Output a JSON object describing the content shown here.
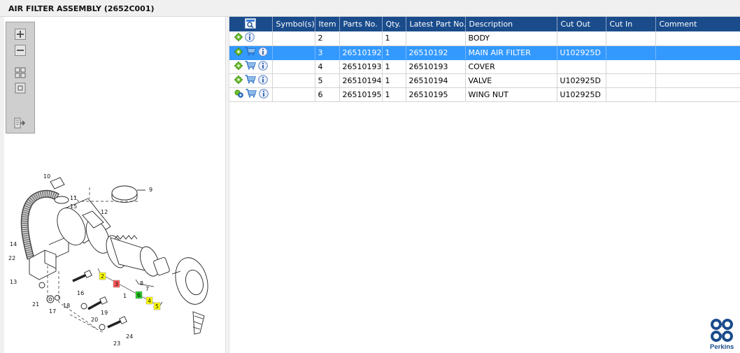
{
  "window": {
    "title": "AIR FILTER ASSEMBLY (2652C001)"
  },
  "colors": {
    "header_bg": "#1a4c8c",
    "selected_row": "#3399ff",
    "highlight_yellow": "#ffff00",
    "highlight_red": "#ff5555",
    "highlight_green": "#22cc22"
  },
  "toolbox": {
    "icons": [
      "zoom-in-icon",
      "zoom-out-icon",
      "fit-window-icon",
      "actual-size-icon",
      "export-icon"
    ]
  },
  "drawing": {
    "callouts": [
      "10",
      "9",
      "11",
      "15",
      "12",
      "14",
      "22",
      "13",
      "16",
      "1",
      "8",
      "7",
      "21",
      "17",
      "18",
      "19",
      "20",
      "23",
      "24",
      "4",
      "5"
    ],
    "highlighted_callouts": [
      {
        "label": "2",
        "color": "yellow"
      },
      {
        "label": "3",
        "color": "red"
      },
      {
        "label": "6",
        "color": "green"
      },
      {
        "label": "4",
        "color": "yellow"
      },
      {
        "label": "5",
        "color": "yellow"
      }
    ]
  },
  "table": {
    "columns": [
      "",
      "Symbol(s)",
      "Item",
      "Parts No.",
      "Qty.",
      "Latest Part No.",
      "Description",
      "Cut Out",
      "Cut In",
      "Comment"
    ],
    "rows": [
      {
        "item": "2",
        "parts_no": "",
        "qty": "1",
        "latest": "",
        "description": "BODY",
        "cut_out": "",
        "cut_in": "",
        "comment": "",
        "cart": false,
        "selected": false
      },
      {
        "item": "3",
        "parts_no": "26510192",
        "qty": "1",
        "latest": "26510192",
        "description": "MAIN AIR FILTER",
        "cut_out": "U102925D",
        "cut_in": "",
        "comment": "",
        "cart": true,
        "selected": true
      },
      {
        "item": "4",
        "parts_no": "26510193",
        "qty": "1",
        "latest": "26510193",
        "description": "COVER",
        "cut_out": "",
        "cut_in": "",
        "comment": "",
        "cart": true,
        "selected": false
      },
      {
        "item": "5",
        "parts_no": "26510194",
        "qty": "1",
        "latest": "26510194",
        "description": "VALVE",
        "cut_out": "U102925D",
        "cut_in": "",
        "comment": "",
        "cart": true,
        "selected": false
      },
      {
        "item": "6",
        "parts_no": "26510195",
        "qty": "1",
        "latest": "26510195",
        "description": "WING NUT",
        "cut_out": "U102925D",
        "cut_in": "",
        "comment": "",
        "cart": true,
        "selected": false
      }
    ]
  },
  "brand": {
    "name": "Perkins"
  }
}
